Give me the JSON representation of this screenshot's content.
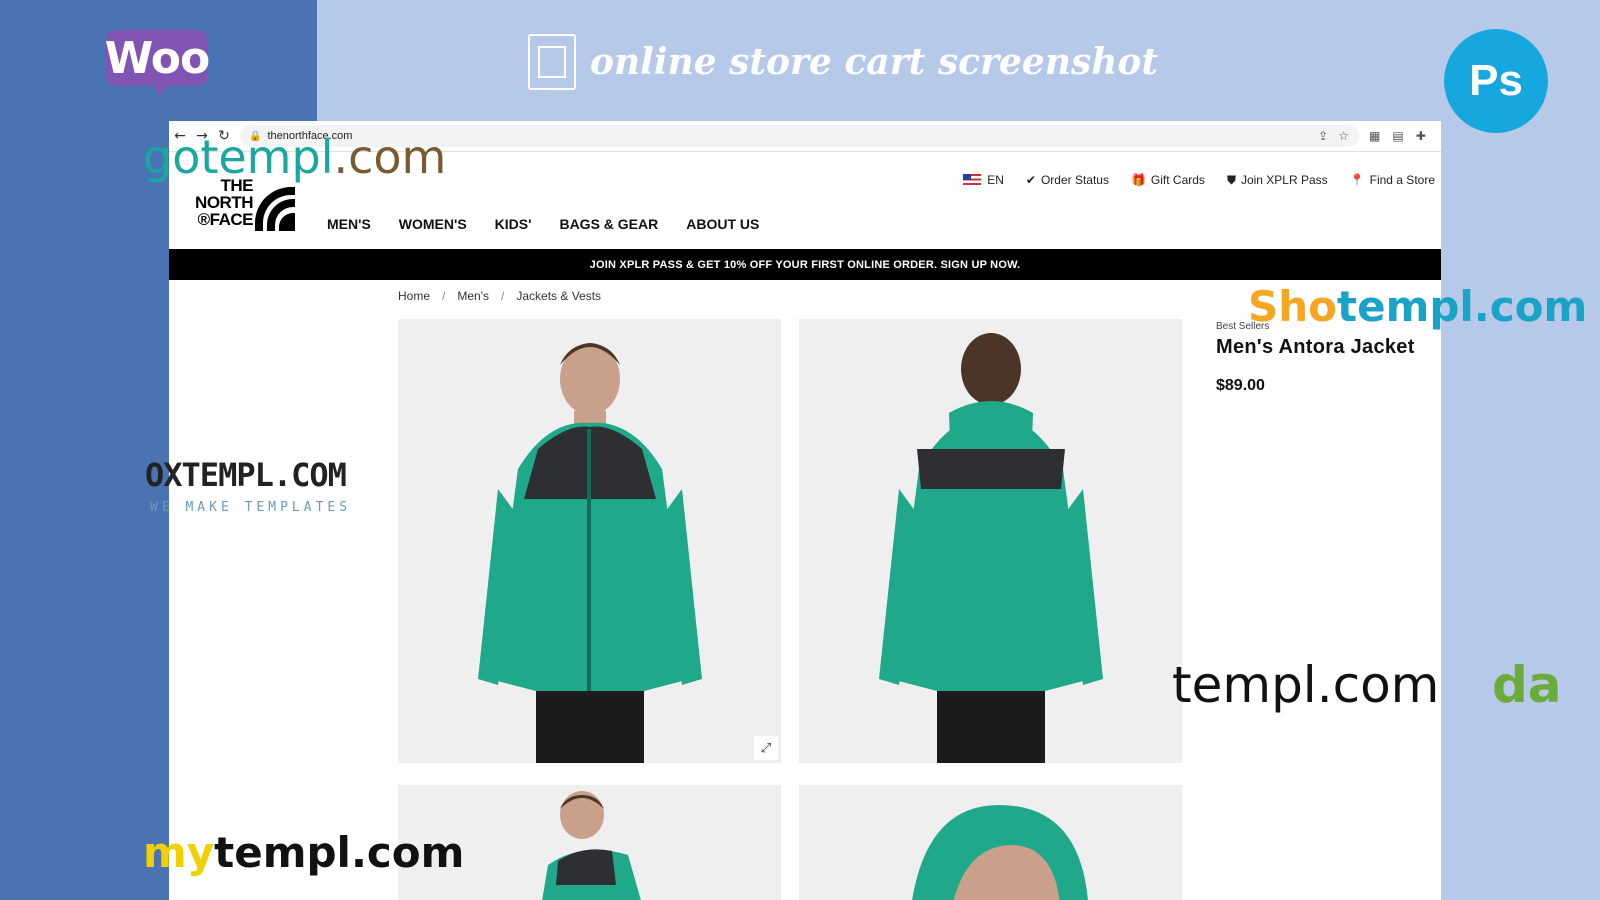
{
  "banner": {
    "woo_label": "Woo",
    "title": "online store cart screenshot",
    "ps_label": "Ps"
  },
  "browser": {
    "url": "thenorthface.com"
  },
  "topbar": {
    "language": "EN",
    "order_status": "Order Status",
    "gift_cards": "Gift Cards",
    "join_xplr": "Join XPLR Pass",
    "find_store": "Find a Store"
  },
  "logo": {
    "line1": "THE",
    "line2": "NORTH",
    "line3": "®FACE"
  },
  "nav": {
    "items": [
      {
        "label": "MEN'S"
      },
      {
        "label": "WOMEN'S"
      },
      {
        "label": "KIDS'"
      },
      {
        "label": "BAGS & GEAR"
      },
      {
        "label": "ABOUT US"
      }
    ]
  },
  "promo": {
    "text": "JOIN XPLR PASS & GET 10% OFF YOUR FIRST ONLINE ORDER. SIGN UP NOW."
  },
  "breadcrumb": {
    "items": [
      "Home",
      "Men's",
      "Jackets & Vests"
    ],
    "separator": "/"
  },
  "product": {
    "tag": "Best Sellers",
    "name": "Men's Antora Jacket",
    "price": "$89.00",
    "jacket_color": "#1fa88a",
    "shoulder_color": "#2e2f33"
  },
  "watermarks": {
    "gotempl_a": "gotempl",
    "gotempl_b": ".com",
    "shot_a": "Sho",
    "shot_b": "templ.com",
    "ox": "OXTEMPL.COM",
    "ox_sub": "WE MAKE TEMPLATES",
    "templ": "templ.com",
    "da": "da",
    "my_a": "my",
    "my_b": "templ.com"
  }
}
